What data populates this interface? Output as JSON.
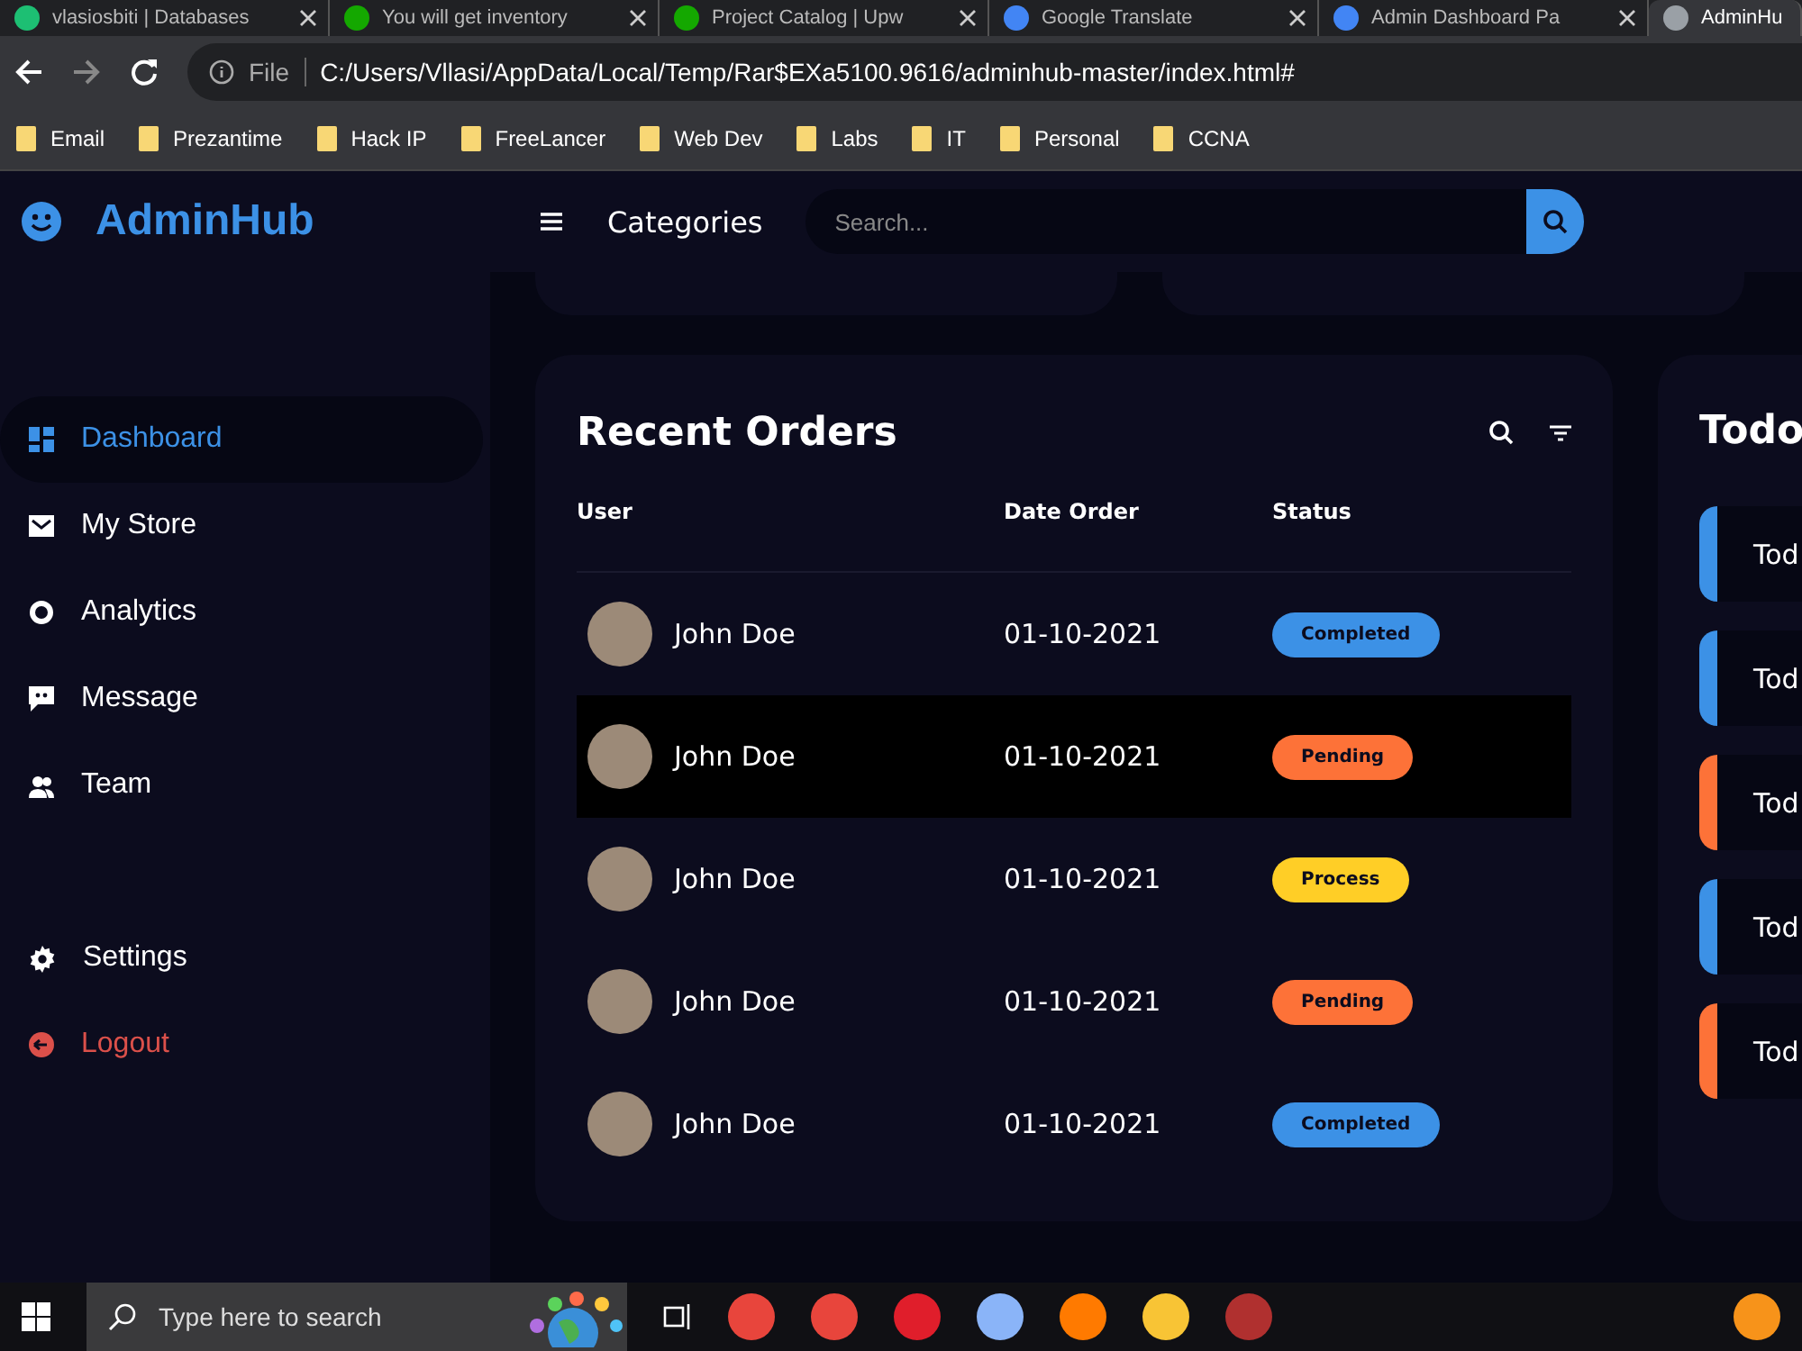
{
  "browser": {
    "tabs": [
      {
        "title": "vlasiosbiti | Databases",
        "selected": false,
        "color": "#1dbf73"
      },
      {
        "title": "You will get inventory",
        "selected": false,
        "color": "#14a800"
      },
      {
        "title": "Project Catalog | Upw",
        "selected": false,
        "color": "#14a800"
      },
      {
        "title": "Google Translate",
        "selected": false,
        "color": "#4285f4"
      },
      {
        "title": "Admin Dashboard Pa",
        "selected": false,
        "color": "#4285f4"
      },
      {
        "title": "AdminHu",
        "selected": true,
        "color": "#9aa0a6"
      }
    ],
    "scheme": "File",
    "url": "C:/Users/Vllasi/AppData/Local/Temp/Rar$EXa5100.9616/adminhub-master/index.html#",
    "bookmarks": [
      "Email",
      "Prezantime",
      "Hack IP",
      "FreeLancer",
      "Web Dev",
      "Labs",
      "IT",
      "Personal",
      "CCNA"
    ]
  },
  "brand": "AdminHub",
  "sidebar": {
    "items": [
      {
        "label": "Dashboard",
        "selected": true
      },
      {
        "label": "My Store",
        "selected": false
      },
      {
        "label": "Analytics",
        "selected": false
      },
      {
        "label": "Message",
        "selected": false
      },
      {
        "label": "Team",
        "selected": false
      }
    ],
    "bottom_items": [
      {
        "label": "Settings",
        "kind": "normal"
      },
      {
        "label": "Logout",
        "kind": "danger"
      }
    ]
  },
  "nav": {
    "link": "Categories",
    "search": {
      "placeholder": "Search..."
    }
  },
  "orders": {
    "title": "Recent Orders",
    "columns": [
      "User",
      "Date Order",
      "Status"
    ],
    "rows": [
      {
        "user": "John Doe",
        "date": "01-10-2021",
        "status": "Completed",
        "kind": "completed",
        "highlighted": false
      },
      {
        "user": "John Doe",
        "date": "01-10-2021",
        "status": "Pending",
        "kind": "pending",
        "highlighted": true
      },
      {
        "user": "John Doe",
        "date": "01-10-2021",
        "status": "Process",
        "kind": "process",
        "highlighted": false
      },
      {
        "user": "John Doe",
        "date": "01-10-2021",
        "status": "Pending",
        "kind": "pending",
        "highlighted": false
      },
      {
        "user": "John Doe",
        "date": "01-10-2021",
        "status": "Completed",
        "kind": "completed",
        "highlighted": false
      }
    ]
  },
  "todos": {
    "title": "Todo",
    "items": [
      {
        "text": "Tod",
        "color": "#3c91e6"
      },
      {
        "text": "Tod",
        "color": "#3c91e6"
      },
      {
        "text": "Tod",
        "color": "#fd7238"
      },
      {
        "text": "Tod",
        "color": "#3c91e6"
      },
      {
        "text": "Tod",
        "color": "#fd7238"
      }
    ]
  },
  "taskbar": {
    "search": {
      "placeholder": "Type here to search"
    }
  }
}
